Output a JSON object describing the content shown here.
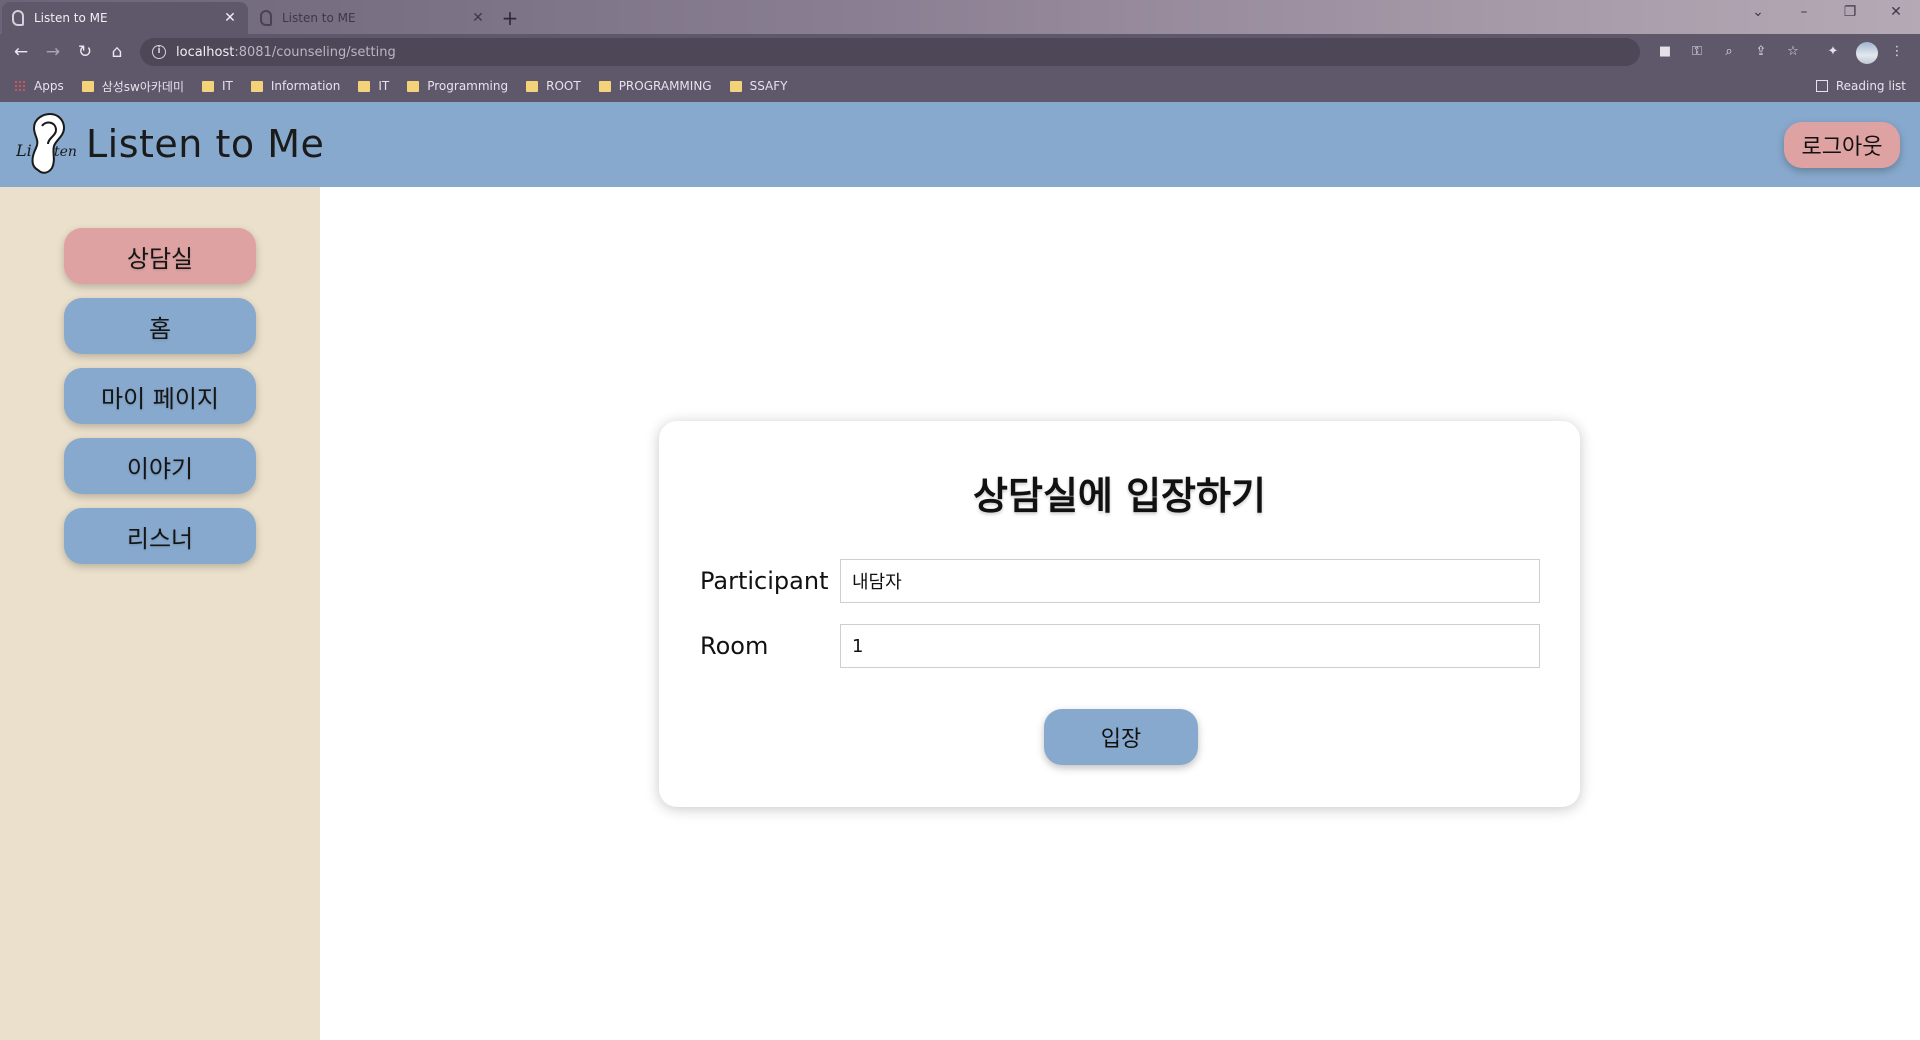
{
  "browser": {
    "tabs": [
      {
        "title": "Listen to ME",
        "active": true
      },
      {
        "title": "Listen to ME",
        "active": false
      }
    ],
    "url_host": "localhost",
    "url_path": ":8081/counseling/setting",
    "bookmarks": [
      "Apps",
      "삼성sw아카데미",
      "IT",
      "Information",
      "IT",
      "Programming",
      "ROOT",
      "PROGRAMMING",
      "SSAFY"
    ],
    "reading_list": "Reading list"
  },
  "app": {
    "brand": "Listen to Me",
    "logout_label": "로그아웃",
    "colors": {
      "primary": "#87a9cd",
      "accent": "#dfa2a2",
      "sidebar_bg": "#ebe0cb"
    }
  },
  "sidebar": {
    "items": [
      {
        "label": "상담실",
        "active": true
      },
      {
        "label": "홈",
        "active": false
      },
      {
        "label": "마이 페이지",
        "active": false
      },
      {
        "label": "이야기",
        "active": false
      },
      {
        "label": "리스너",
        "active": false
      }
    ]
  },
  "form": {
    "title": "상담실에 입장하기",
    "participant_label": "Participant",
    "participant_value": "내담자",
    "room_label": "Room",
    "room_value": "1",
    "submit_label": "입장"
  }
}
